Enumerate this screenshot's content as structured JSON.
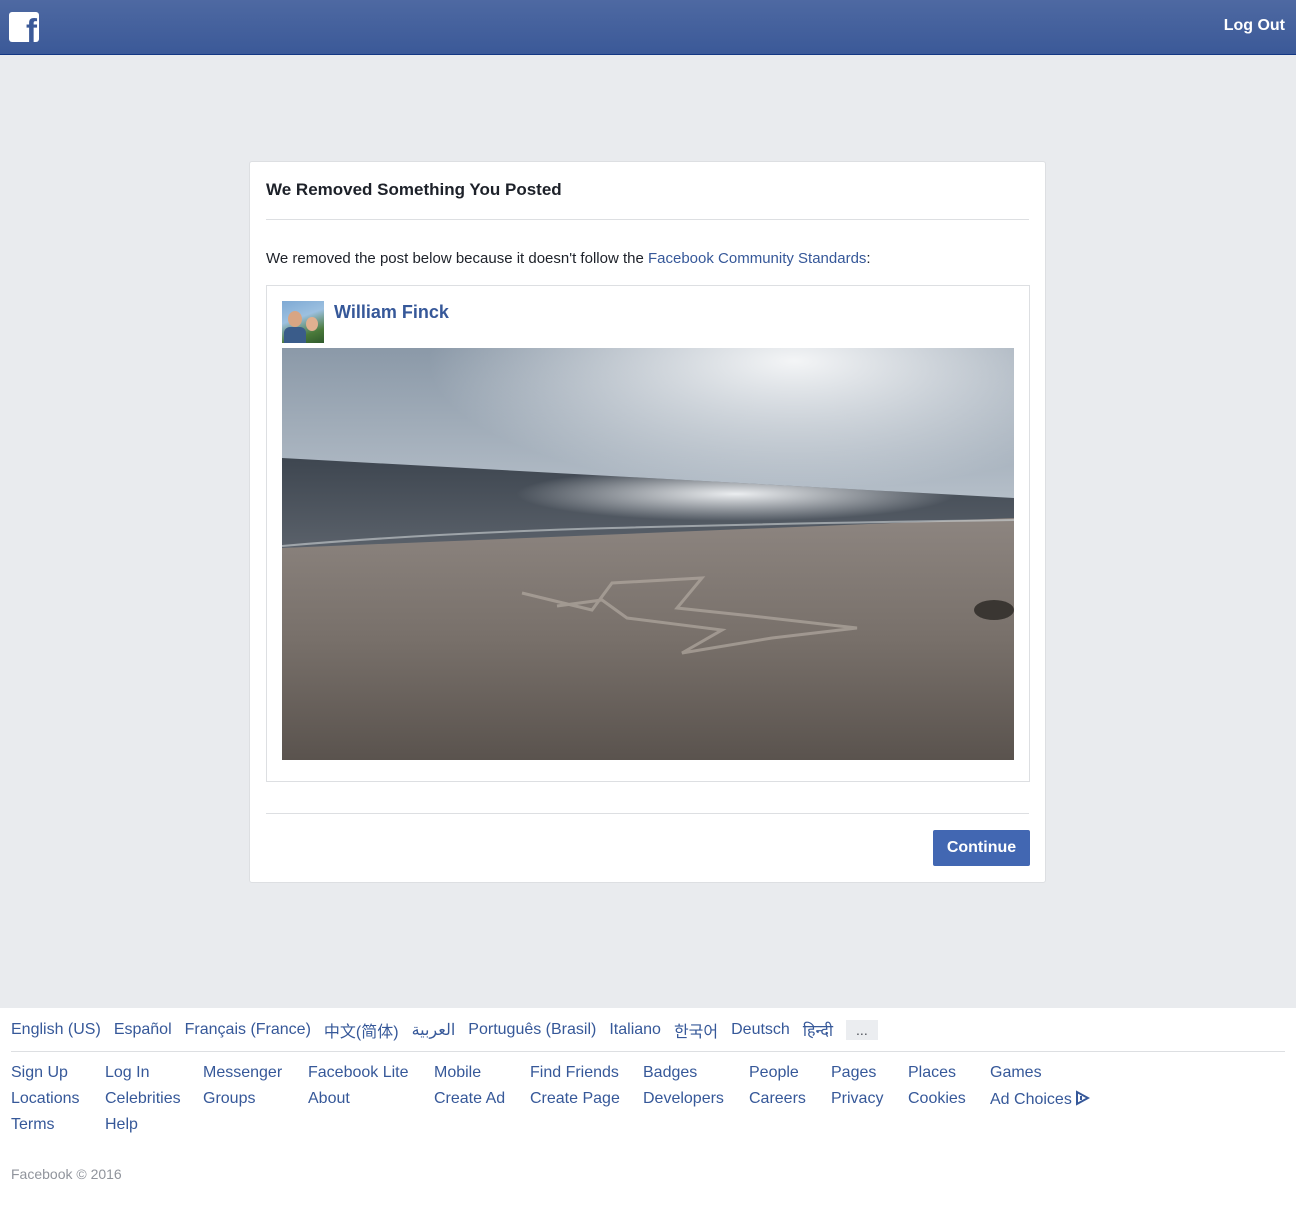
{
  "header": {
    "logo": "f",
    "logout_label": "Log Out"
  },
  "dialog": {
    "title": "We Removed Something You Posted",
    "message_prefix": "We removed the post below because it doesn't follow the ",
    "message_link": "Facebook Community Standards",
    "message_suffix": ":",
    "post": {
      "author": "William Finck"
    },
    "continue_label": "Continue"
  },
  "footer": {
    "languages": [
      "English (US)",
      "Español",
      "Français (France)",
      "中文(简体)",
      "العربية",
      "Português (Brasil)",
      "Italiano",
      "한국어",
      "Deutsch",
      "हिन्दी"
    ],
    "more_languages": "...",
    "links": {
      "sign_up": "Sign Up",
      "log_in": "Log In",
      "messenger": "Messenger",
      "facebook_lite": "Facebook Lite",
      "mobile": "Mobile",
      "find_friends": "Find Friends",
      "badges": "Badges",
      "people": "People",
      "pages": "Pages",
      "places": "Places",
      "games": "Games",
      "locations": "Locations",
      "celebrities": "Celebrities",
      "groups": "Groups",
      "about": "About",
      "create_ad": "Create Ad",
      "create_page": "Create Page",
      "developers": "Developers",
      "careers": "Careers",
      "privacy": "Privacy",
      "cookies": "Cookies",
      "ad_choices": "Ad Choices",
      "terms": "Terms",
      "help": "Help"
    },
    "copyright": "Facebook © 2016"
  },
  "colors": {
    "brand_blue": "#3b5998",
    "link_blue": "#365899",
    "button_blue": "#4267b2",
    "page_bg": "#e9ebee"
  }
}
